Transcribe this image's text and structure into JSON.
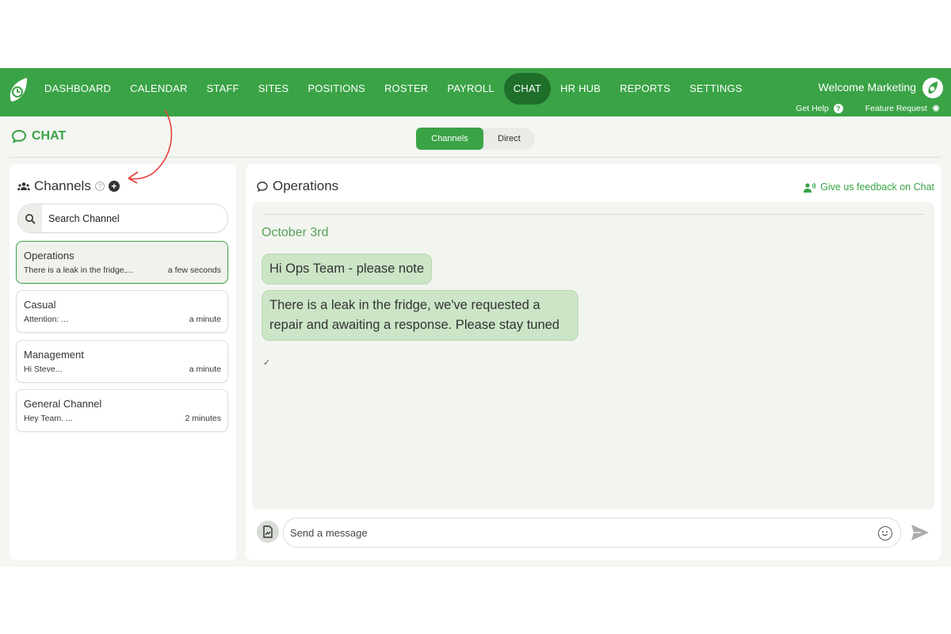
{
  "nav": {
    "items": [
      {
        "label": "DASHBOARD",
        "active": false
      },
      {
        "label": "CALENDAR",
        "active": false
      },
      {
        "label": "STAFF",
        "active": false
      },
      {
        "label": "SITES",
        "active": false
      },
      {
        "label": "POSITIONS",
        "active": false
      },
      {
        "label": "ROSTER",
        "active": false
      },
      {
        "label": "PAYROLL",
        "active": false
      },
      {
        "label": "CHAT",
        "active": true
      },
      {
        "label": "HR HUB",
        "active": false
      },
      {
        "label": "REPORTS",
        "active": false
      },
      {
        "label": "SETTINGS",
        "active": false
      }
    ],
    "welcome": "Welcome Marketing",
    "get_help": "Get Help",
    "feature_request": "Feature Request"
  },
  "page": {
    "title": "CHAT",
    "toggle": {
      "channels": "Channels",
      "direct": "Direct",
      "selected": "Channels"
    }
  },
  "channels": {
    "heading": "Channels",
    "search_placeholder": "Search Channel",
    "items": [
      {
        "name": "Operations",
        "preview": "There is a leak in the fridge,...",
        "time": "a few seconds",
        "selected": true
      },
      {
        "name": "Casual",
        "preview": "Attention: ...",
        "time": "a minute",
        "selected": false
      },
      {
        "name": "Management",
        "preview": "Hi Steve...",
        "time": "a minute",
        "selected": false
      },
      {
        "name": "General Channel",
        "preview": "Hey Team. ...",
        "time": "2 minutes",
        "selected": false
      }
    ]
  },
  "conversation": {
    "title": "Operations",
    "feedback": "Give us feedback on Chat",
    "date": "October 3rd",
    "messages": [
      {
        "text": "Hi Ops Team - please note"
      },
      {
        "text": "There is a leak in the fridge, we've requested a repair and awaiting a response. Please stay tuned"
      }
    ],
    "read_mark": "✓",
    "composer_placeholder": "Send a message"
  },
  "colors": {
    "brand_green": "#3aa346",
    "nav_active": "#1f6e2a",
    "bubble": "#cbe5c6"
  }
}
